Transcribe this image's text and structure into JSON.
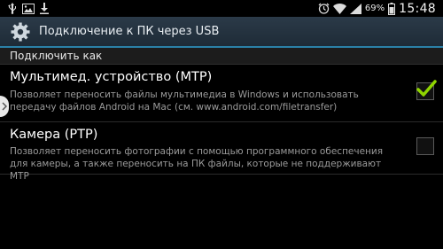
{
  "status_bar": {
    "battery_percent": "69%",
    "time": "15:48",
    "left_icons": [
      "usb-icon",
      "image-icon",
      "download-icon"
    ],
    "right_icons": [
      "alarm-icon",
      "wifi-icon",
      "signal-icon",
      "battery-icon"
    ]
  },
  "action_bar": {
    "title": "Подключение к ПК через USB",
    "icon": "gear-icon",
    "accent_color": "#2a81a8"
  },
  "section": {
    "header": "Подключить как"
  },
  "options": [
    {
      "title": "Мультимед. устройство (MTP)",
      "description_line1": "Позволяет переносить файлы мультимедиа в Windows и использовать",
      "description_line2": "передачу файлов Android на Mac (см. www.android.com/filetransfer)",
      "checked": true
    },
    {
      "title": "Камера (PTP)",
      "description_line1": "Позволяет переносить фотографии с помощью программного обеспечения",
      "description_line2": "для камеры, а также переносить на ПК файлы, которые не поддерживают MTP",
      "checked": false
    }
  ],
  "colors": {
    "check_green": "#8fd400",
    "background": "#000000"
  }
}
